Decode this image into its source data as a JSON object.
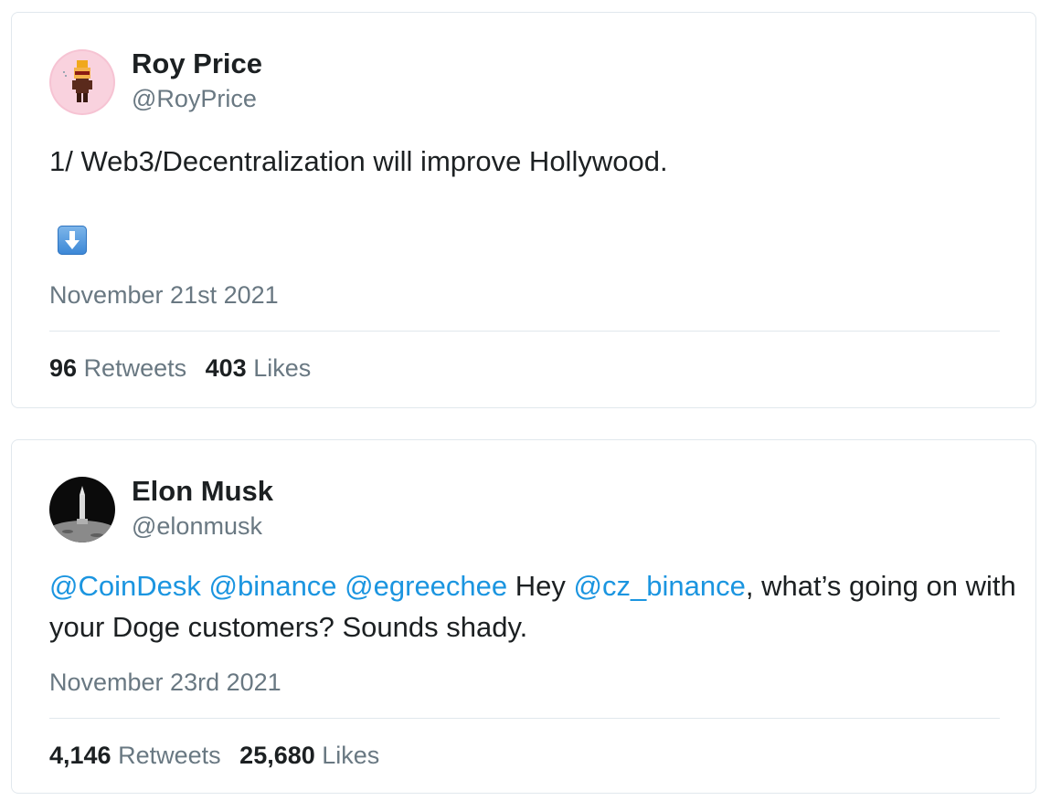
{
  "tweets": [
    {
      "author": {
        "name": "Roy Price",
        "handle": "@RoyPrice"
      },
      "text": "1/ Web3/Decentralization will improve Hollywood.",
      "emoji": "down-arrow-emoji",
      "date": "November 21st 2021",
      "stats": {
        "retweets_count": "96",
        "retweets_label": "Retweets",
        "likes_count": "403",
        "likes_label": "Likes"
      }
    },
    {
      "author": {
        "name": "Elon Musk",
        "handle": "@elonmusk"
      },
      "text_parts": {
        "m1": "@CoinDesk",
        "m2": "@binance",
        "m3": "@egreechee",
        "t1": "Hey",
        "m4": "@cz_binance",
        "t2": ", what’s going on with your Doge customers? Sounds shady."
      },
      "date": "November 23rd 2021",
      "stats": {
        "retweets_count": "4,146",
        "retweets_label": "Retweets",
        "likes_count": "25,680",
        "likes_label": "Likes"
      }
    }
  ],
  "colors": {
    "text": "#1c2022",
    "secondary": "#697882",
    "link": "#1b95e0",
    "border": "#e1e8ed"
  }
}
